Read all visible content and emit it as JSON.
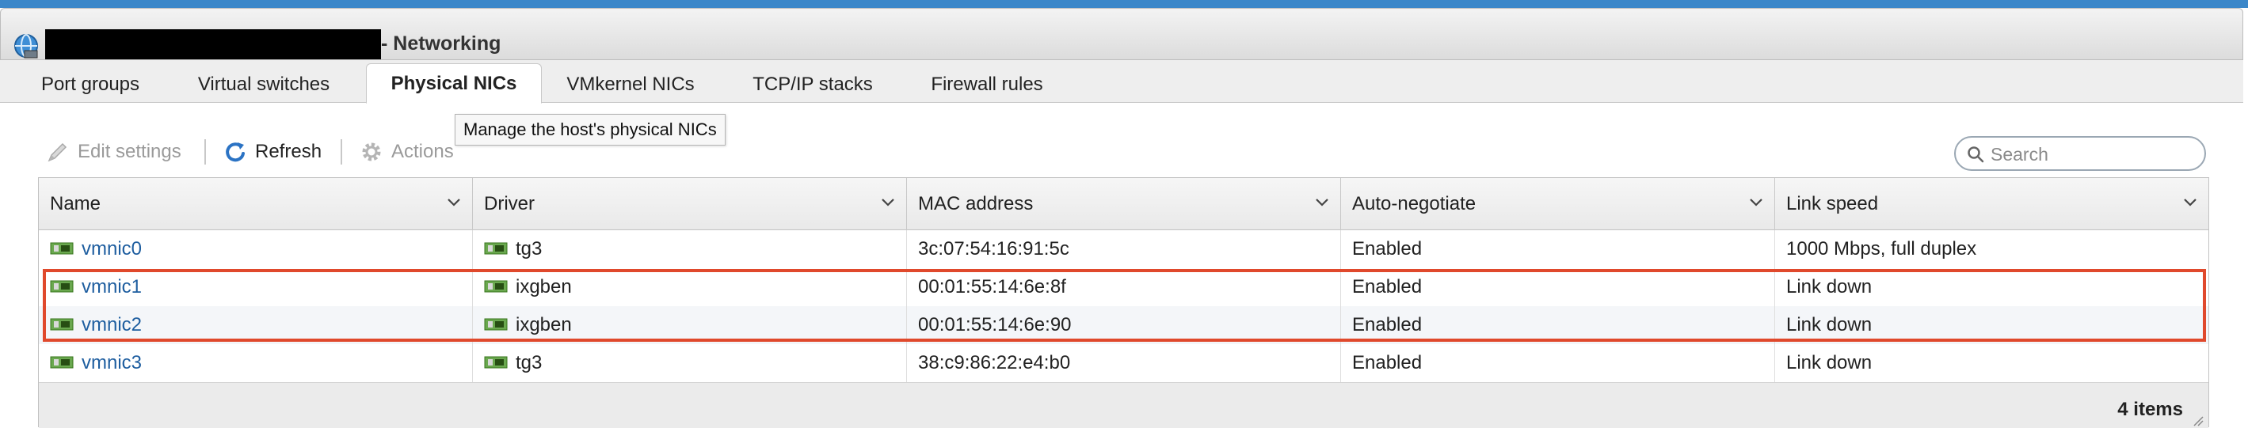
{
  "window": {
    "title": "- Networking",
    "redacted_hostname": ""
  },
  "tabs": [
    {
      "label": "Port groups",
      "active": false
    },
    {
      "label": "Virtual switches",
      "active": false
    },
    {
      "label": "Physical NICs",
      "active": true
    },
    {
      "label": "VMkernel NICs",
      "active": false
    },
    {
      "label": "TCP/IP stacks",
      "active": false
    },
    {
      "label": "Firewall rules",
      "active": false
    }
  ],
  "tooltip": "Manage the host's physical NICs",
  "toolbar": {
    "edit_label": "Edit settings",
    "refresh_label": "Refresh",
    "actions_label": "Actions"
  },
  "search": {
    "placeholder": "Search",
    "value": ""
  },
  "table": {
    "columns": [
      "Name",
      "Driver",
      "MAC address",
      "Auto-negotiate",
      "Link speed"
    ],
    "rows": [
      {
        "name": "vmnic0",
        "driver": "tg3",
        "mac": "3c:07:54:16:91:5c",
        "auto": "Enabled",
        "speed": "1000 Mbps, full duplex"
      },
      {
        "name": "vmnic1",
        "driver": "ixgben",
        "mac": "00:01:55:14:6e:8f",
        "auto": "Enabled",
        "speed": "Link down"
      },
      {
        "name": "vmnic2",
        "driver": "ixgben",
        "mac": "00:01:55:14:6e:90",
        "auto": "Enabled",
        "speed": "Link down"
      },
      {
        "name": "vmnic3",
        "driver": "tg3",
        "mac": "38:c9:86:22:e4:b0",
        "auto": "Enabled",
        "speed": "Link down"
      }
    ],
    "footer_count": "4 items"
  },
  "colors": {
    "accent": "#3b87c9",
    "link": "#1d5d9f",
    "highlight": "#e0492c"
  }
}
